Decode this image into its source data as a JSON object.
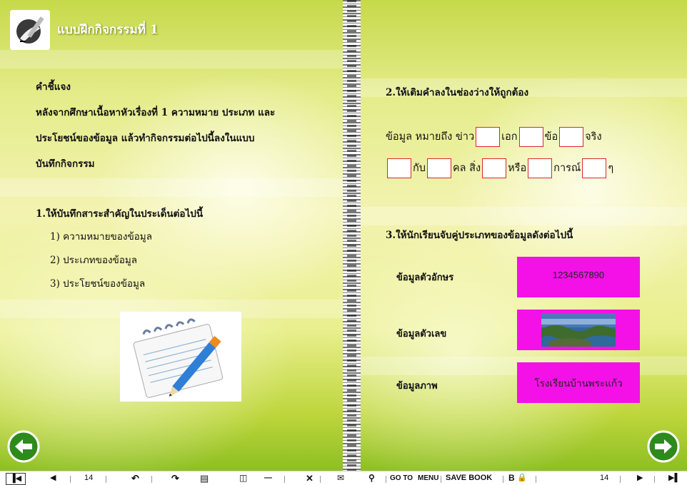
{
  "left_page": {
    "title": "แบบฝึกกิจกรรมที่ 1",
    "instructions_heading": "คำชี้แจง",
    "instructions_lines": [
      "หลังจากศึกษาเนื้อหาหัวเรื่องที่ 1 ความหมาย ประเภท และ",
      "ประโยชน์ของข้อมูล   แล้วทำกิจกรรมต่อไปนี้ลงในแบบ",
      "บันทึกกิจกรรม"
    ],
    "q1_heading": "1.ให้บันทึกสาระสำคัญในประเด็นต่อไปนี้",
    "q1_items": [
      "1) ความหมายของข้อมูล",
      "2) ประเภทของข้อมูล",
      "3) ประโยชน์ของข้อมูล"
    ]
  },
  "right_page": {
    "q2_heading": "2.ให้เติมคำลงในช่องว่างให้ถูกต้อง",
    "q2_line1": [
      "ข้อมูล  หมายถึง  ข่าว",
      "เอก",
      "ข้อ",
      "จริง"
    ],
    "q2_line2": [
      "",
      "กับ",
      "คล สิ่ง",
      "หรือ",
      "การณ์",
      "ๆ"
    ],
    "q3_heading": "3.ให้นักเรียนจับคู่ประเภทของข้อมูลดังต่อไปนี้",
    "match_labels": [
      "ข้อมูลตัวอักษร",
      "ข้อมูลตัวเลข",
      "ข้อมูลภาพ"
    ],
    "match_boxes": [
      "1234567890",
      "",
      "โรงเรียนบ้านพระแก้ว"
    ]
  },
  "toolbar": {
    "page_left": "14",
    "page_right": "14",
    "goto_label": "GO TO",
    "menu_label": "MENU",
    "save_label": "SAVE BOOK",
    "bold_label": "B"
  },
  "colors": {
    "accent_magenta": "#f311e7",
    "blank_border": "#e0262b",
    "nav_green": "#2e8a1c"
  }
}
